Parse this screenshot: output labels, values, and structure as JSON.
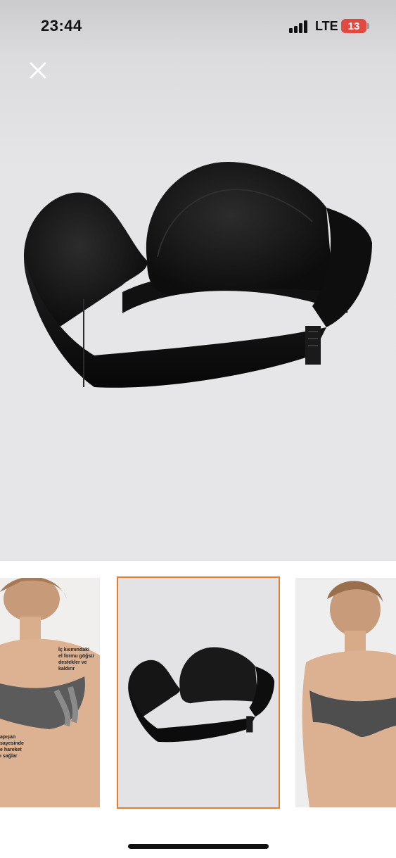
{
  "status_bar": {
    "time": "23:44",
    "network": "LTE",
    "battery": "13"
  },
  "viewer": {
    "close_icon": "close-icon",
    "selected_index": 1,
    "accent_color": "#e97d2f"
  },
  "thumbnails": [
    {
      "callout_top": "İç kısmındaki\nel formu göğsü\ndestekler ve\nkaldırır",
      "callout_bottom": "apışan\nsayesinde\ne hareket\nı sağlar"
    },
    {},
    {}
  ]
}
